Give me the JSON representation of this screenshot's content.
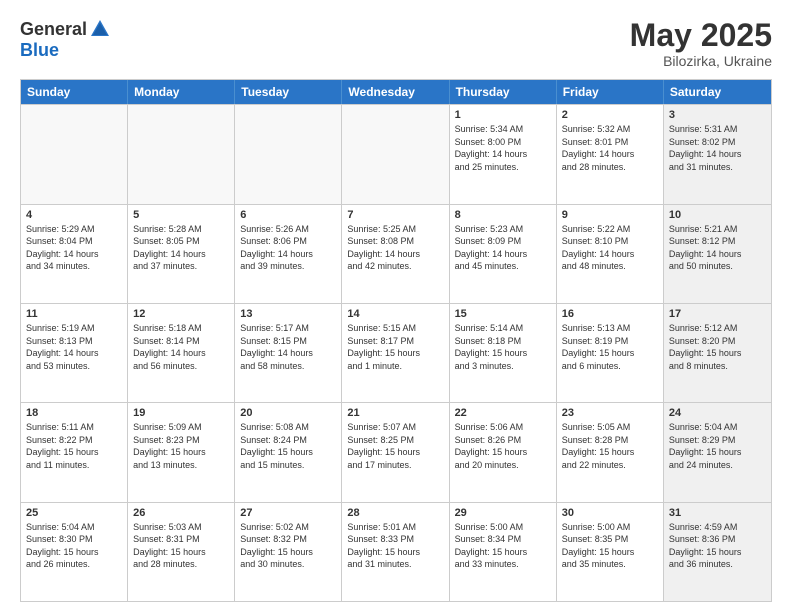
{
  "logo": {
    "general": "General",
    "blue": "Blue"
  },
  "title": "May 2025",
  "subtitle": "Bilozirka, Ukraine",
  "header_days": [
    "Sunday",
    "Monday",
    "Tuesday",
    "Wednesday",
    "Thursday",
    "Friday",
    "Saturday"
  ],
  "rows": [
    [
      {
        "day": "",
        "info": "",
        "empty": true
      },
      {
        "day": "",
        "info": "",
        "empty": true
      },
      {
        "day": "",
        "info": "",
        "empty": true
      },
      {
        "day": "",
        "info": "",
        "empty": true
      },
      {
        "day": "1",
        "info": "Sunrise: 5:34 AM\nSunset: 8:00 PM\nDaylight: 14 hours\nand 25 minutes."
      },
      {
        "day": "2",
        "info": "Sunrise: 5:32 AM\nSunset: 8:01 PM\nDaylight: 14 hours\nand 28 minutes."
      },
      {
        "day": "3",
        "info": "Sunrise: 5:31 AM\nSunset: 8:02 PM\nDaylight: 14 hours\nand 31 minutes.",
        "shaded": true
      }
    ],
    [
      {
        "day": "4",
        "info": "Sunrise: 5:29 AM\nSunset: 8:04 PM\nDaylight: 14 hours\nand 34 minutes."
      },
      {
        "day": "5",
        "info": "Sunrise: 5:28 AM\nSunset: 8:05 PM\nDaylight: 14 hours\nand 37 minutes."
      },
      {
        "day": "6",
        "info": "Sunrise: 5:26 AM\nSunset: 8:06 PM\nDaylight: 14 hours\nand 39 minutes."
      },
      {
        "day": "7",
        "info": "Sunrise: 5:25 AM\nSunset: 8:08 PM\nDaylight: 14 hours\nand 42 minutes."
      },
      {
        "day": "8",
        "info": "Sunrise: 5:23 AM\nSunset: 8:09 PM\nDaylight: 14 hours\nand 45 minutes."
      },
      {
        "day": "9",
        "info": "Sunrise: 5:22 AM\nSunset: 8:10 PM\nDaylight: 14 hours\nand 48 minutes."
      },
      {
        "day": "10",
        "info": "Sunrise: 5:21 AM\nSunset: 8:12 PM\nDaylight: 14 hours\nand 50 minutes.",
        "shaded": true
      }
    ],
    [
      {
        "day": "11",
        "info": "Sunrise: 5:19 AM\nSunset: 8:13 PM\nDaylight: 14 hours\nand 53 minutes."
      },
      {
        "day": "12",
        "info": "Sunrise: 5:18 AM\nSunset: 8:14 PM\nDaylight: 14 hours\nand 56 minutes."
      },
      {
        "day": "13",
        "info": "Sunrise: 5:17 AM\nSunset: 8:15 PM\nDaylight: 14 hours\nand 58 minutes."
      },
      {
        "day": "14",
        "info": "Sunrise: 5:15 AM\nSunset: 8:17 PM\nDaylight: 15 hours\nand 1 minute."
      },
      {
        "day": "15",
        "info": "Sunrise: 5:14 AM\nSunset: 8:18 PM\nDaylight: 15 hours\nand 3 minutes."
      },
      {
        "day": "16",
        "info": "Sunrise: 5:13 AM\nSunset: 8:19 PM\nDaylight: 15 hours\nand 6 minutes."
      },
      {
        "day": "17",
        "info": "Sunrise: 5:12 AM\nSunset: 8:20 PM\nDaylight: 15 hours\nand 8 minutes.",
        "shaded": true
      }
    ],
    [
      {
        "day": "18",
        "info": "Sunrise: 5:11 AM\nSunset: 8:22 PM\nDaylight: 15 hours\nand 11 minutes."
      },
      {
        "day": "19",
        "info": "Sunrise: 5:09 AM\nSunset: 8:23 PM\nDaylight: 15 hours\nand 13 minutes."
      },
      {
        "day": "20",
        "info": "Sunrise: 5:08 AM\nSunset: 8:24 PM\nDaylight: 15 hours\nand 15 minutes."
      },
      {
        "day": "21",
        "info": "Sunrise: 5:07 AM\nSunset: 8:25 PM\nDaylight: 15 hours\nand 17 minutes."
      },
      {
        "day": "22",
        "info": "Sunrise: 5:06 AM\nSunset: 8:26 PM\nDaylight: 15 hours\nand 20 minutes."
      },
      {
        "day": "23",
        "info": "Sunrise: 5:05 AM\nSunset: 8:28 PM\nDaylight: 15 hours\nand 22 minutes."
      },
      {
        "day": "24",
        "info": "Sunrise: 5:04 AM\nSunset: 8:29 PM\nDaylight: 15 hours\nand 24 minutes.",
        "shaded": true
      }
    ],
    [
      {
        "day": "25",
        "info": "Sunrise: 5:04 AM\nSunset: 8:30 PM\nDaylight: 15 hours\nand 26 minutes."
      },
      {
        "day": "26",
        "info": "Sunrise: 5:03 AM\nSunset: 8:31 PM\nDaylight: 15 hours\nand 28 minutes."
      },
      {
        "day": "27",
        "info": "Sunrise: 5:02 AM\nSunset: 8:32 PM\nDaylight: 15 hours\nand 30 minutes."
      },
      {
        "day": "28",
        "info": "Sunrise: 5:01 AM\nSunset: 8:33 PM\nDaylight: 15 hours\nand 31 minutes."
      },
      {
        "day": "29",
        "info": "Sunrise: 5:00 AM\nSunset: 8:34 PM\nDaylight: 15 hours\nand 33 minutes."
      },
      {
        "day": "30",
        "info": "Sunrise: 5:00 AM\nSunset: 8:35 PM\nDaylight: 15 hours\nand 35 minutes."
      },
      {
        "day": "31",
        "info": "Sunrise: 4:59 AM\nSunset: 8:36 PM\nDaylight: 15 hours\nand 36 minutes.",
        "shaded": true
      }
    ]
  ]
}
